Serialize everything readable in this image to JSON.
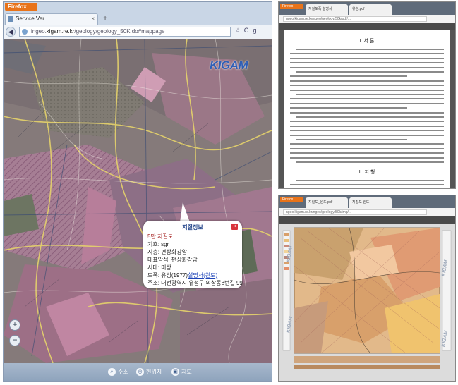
{
  "browser": {
    "menu_label": "Firefox",
    "tab_title": "Service Ver.",
    "tab_close": "×",
    "new_tab": "+",
    "url_prefix": "ingeo.",
    "url_domain": "kigam.re.kr",
    "url_path": "/geology/geology_50K.do#mappage",
    "back": "◀",
    "nav_icons": [
      "☆",
      "C",
      "g"
    ]
  },
  "map": {
    "logo": "KIGAM",
    "zoom_in": "+",
    "zoom_out": "−"
  },
  "popup": {
    "title": "지질정보",
    "close": "×",
    "sheet": "5만 지질도",
    "symbol": "기호: sgr",
    "strata": "지층: 편상화강암",
    "rock": "대표암석: 편상화강암",
    "era": "시대: 미상",
    "sheet_prefix": "도폭: 유성(1977)",
    "sheet_link": "설명서(원도)",
    "address": "주소: 대전광역시 유성구 외삼동8번길 99"
  },
  "bottom_bar": [
    {
      "icon": "search-icon",
      "label": "주소"
    },
    {
      "icon": "location-icon",
      "label": "현위치"
    },
    {
      "icon": "map-icon",
      "label": "지도"
    }
  ],
  "doc_window": {
    "menu_label": "Firefox",
    "tabs": [
      "지질도폭 설명서",
      "유성.pdf"
    ],
    "url": "ngeo.kigam.re.kr/ngeo/geology/50k/pdf/...",
    "section1": "I. 서 론",
    "section2": "II. 지 형"
  },
  "map_window": {
    "menu_label": "Firefox",
    "tabs": [
      "지질도_원도.pdf",
      "지질도 원도"
    ],
    "url": "ngeo.kigam.re.kr/ngeo/geology/50k/img/...",
    "watermark": "KIGAM"
  },
  "colors": {
    "accent": "#1f45b8",
    "popup_title": "#1c3f86",
    "close_red": "#d8343c",
    "firefox_orange": "#e8731a"
  }
}
